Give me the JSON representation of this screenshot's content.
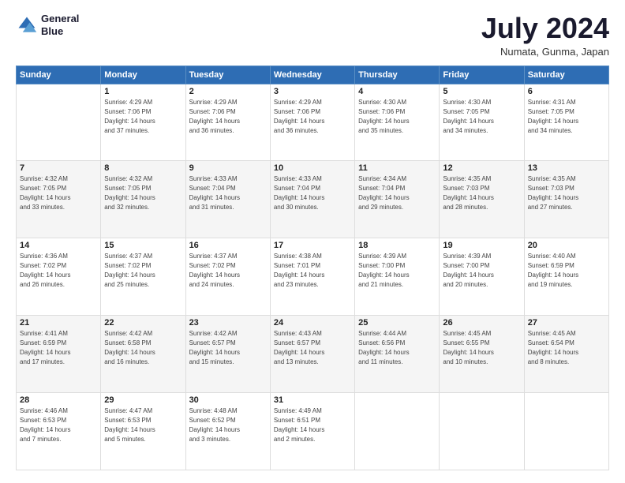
{
  "header": {
    "logo_line1": "General",
    "logo_line2": "Blue",
    "month_title": "July 2024",
    "location": "Numata, Gunma, Japan"
  },
  "days_of_week": [
    "Sunday",
    "Monday",
    "Tuesday",
    "Wednesday",
    "Thursday",
    "Friday",
    "Saturday"
  ],
  "weeks": [
    [
      {
        "day": "",
        "info": ""
      },
      {
        "day": "1",
        "info": "Sunrise: 4:29 AM\nSunset: 7:06 PM\nDaylight: 14 hours\nand 37 minutes."
      },
      {
        "day": "2",
        "info": "Sunrise: 4:29 AM\nSunset: 7:06 PM\nDaylight: 14 hours\nand 36 minutes."
      },
      {
        "day": "3",
        "info": "Sunrise: 4:29 AM\nSunset: 7:06 PM\nDaylight: 14 hours\nand 36 minutes."
      },
      {
        "day": "4",
        "info": "Sunrise: 4:30 AM\nSunset: 7:06 PM\nDaylight: 14 hours\nand 35 minutes."
      },
      {
        "day": "5",
        "info": "Sunrise: 4:30 AM\nSunset: 7:05 PM\nDaylight: 14 hours\nand 34 minutes."
      },
      {
        "day": "6",
        "info": "Sunrise: 4:31 AM\nSunset: 7:05 PM\nDaylight: 14 hours\nand 34 minutes."
      }
    ],
    [
      {
        "day": "7",
        "info": "Sunrise: 4:32 AM\nSunset: 7:05 PM\nDaylight: 14 hours\nand 33 minutes."
      },
      {
        "day": "8",
        "info": "Sunrise: 4:32 AM\nSunset: 7:05 PM\nDaylight: 14 hours\nand 32 minutes."
      },
      {
        "day": "9",
        "info": "Sunrise: 4:33 AM\nSunset: 7:04 PM\nDaylight: 14 hours\nand 31 minutes."
      },
      {
        "day": "10",
        "info": "Sunrise: 4:33 AM\nSunset: 7:04 PM\nDaylight: 14 hours\nand 30 minutes."
      },
      {
        "day": "11",
        "info": "Sunrise: 4:34 AM\nSunset: 7:04 PM\nDaylight: 14 hours\nand 29 minutes."
      },
      {
        "day": "12",
        "info": "Sunrise: 4:35 AM\nSunset: 7:03 PM\nDaylight: 14 hours\nand 28 minutes."
      },
      {
        "day": "13",
        "info": "Sunrise: 4:35 AM\nSunset: 7:03 PM\nDaylight: 14 hours\nand 27 minutes."
      }
    ],
    [
      {
        "day": "14",
        "info": "Sunrise: 4:36 AM\nSunset: 7:02 PM\nDaylight: 14 hours\nand 26 minutes."
      },
      {
        "day": "15",
        "info": "Sunrise: 4:37 AM\nSunset: 7:02 PM\nDaylight: 14 hours\nand 25 minutes."
      },
      {
        "day": "16",
        "info": "Sunrise: 4:37 AM\nSunset: 7:02 PM\nDaylight: 14 hours\nand 24 minutes."
      },
      {
        "day": "17",
        "info": "Sunrise: 4:38 AM\nSunset: 7:01 PM\nDaylight: 14 hours\nand 23 minutes."
      },
      {
        "day": "18",
        "info": "Sunrise: 4:39 AM\nSunset: 7:00 PM\nDaylight: 14 hours\nand 21 minutes."
      },
      {
        "day": "19",
        "info": "Sunrise: 4:39 AM\nSunset: 7:00 PM\nDaylight: 14 hours\nand 20 minutes."
      },
      {
        "day": "20",
        "info": "Sunrise: 4:40 AM\nSunset: 6:59 PM\nDaylight: 14 hours\nand 19 minutes."
      }
    ],
    [
      {
        "day": "21",
        "info": "Sunrise: 4:41 AM\nSunset: 6:59 PM\nDaylight: 14 hours\nand 17 minutes."
      },
      {
        "day": "22",
        "info": "Sunrise: 4:42 AM\nSunset: 6:58 PM\nDaylight: 14 hours\nand 16 minutes."
      },
      {
        "day": "23",
        "info": "Sunrise: 4:42 AM\nSunset: 6:57 PM\nDaylight: 14 hours\nand 15 minutes."
      },
      {
        "day": "24",
        "info": "Sunrise: 4:43 AM\nSunset: 6:57 PM\nDaylight: 14 hours\nand 13 minutes."
      },
      {
        "day": "25",
        "info": "Sunrise: 4:44 AM\nSunset: 6:56 PM\nDaylight: 14 hours\nand 11 minutes."
      },
      {
        "day": "26",
        "info": "Sunrise: 4:45 AM\nSunset: 6:55 PM\nDaylight: 14 hours\nand 10 minutes."
      },
      {
        "day": "27",
        "info": "Sunrise: 4:45 AM\nSunset: 6:54 PM\nDaylight: 14 hours\nand 8 minutes."
      }
    ],
    [
      {
        "day": "28",
        "info": "Sunrise: 4:46 AM\nSunset: 6:53 PM\nDaylight: 14 hours\nand 7 minutes."
      },
      {
        "day": "29",
        "info": "Sunrise: 4:47 AM\nSunset: 6:53 PM\nDaylight: 14 hours\nand 5 minutes."
      },
      {
        "day": "30",
        "info": "Sunrise: 4:48 AM\nSunset: 6:52 PM\nDaylight: 14 hours\nand 3 minutes."
      },
      {
        "day": "31",
        "info": "Sunrise: 4:49 AM\nSunset: 6:51 PM\nDaylight: 14 hours\nand 2 minutes."
      },
      {
        "day": "",
        "info": ""
      },
      {
        "day": "",
        "info": ""
      },
      {
        "day": "",
        "info": ""
      }
    ]
  ]
}
